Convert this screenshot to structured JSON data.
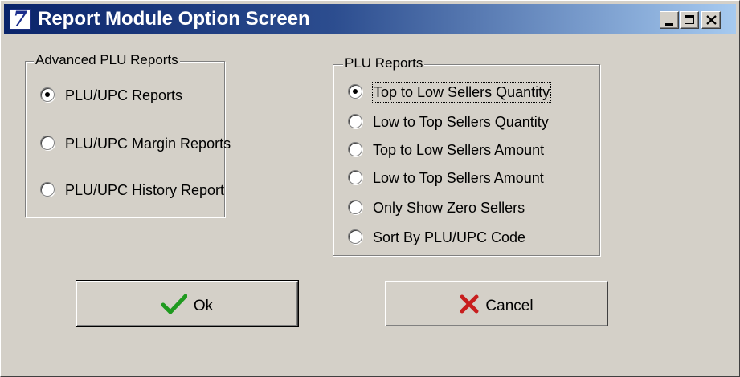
{
  "window": {
    "title": "Report Module Option Screen",
    "icon_glyph": "7",
    "controls": [
      "minimize-icon",
      "maximize-icon",
      "close-icon"
    ]
  },
  "advanced_group": {
    "legend": "Advanced PLU Reports",
    "options": [
      {
        "label": "PLU/UPC Reports",
        "checked": true
      },
      {
        "label": "PLU/UPC Margin Reports",
        "checked": false
      },
      {
        "label": "PLU/UPC History Report",
        "checked": false
      }
    ]
  },
  "plu_group": {
    "legend": "PLU Reports",
    "options": [
      {
        "label": "Top to Low Sellers Quantity",
        "checked": true
      },
      {
        "label": "Low to Top Sellers Quantity",
        "checked": false
      },
      {
        "label": "Top to Low Sellers Amount",
        "checked": false
      },
      {
        "label": "Low to Top Sellers Amount",
        "checked": false
      },
      {
        "label": "Only Show Zero Sellers",
        "checked": false
      },
      {
        "label": "Sort By PLU/UPC Code",
        "checked": false
      }
    ]
  },
  "buttons": {
    "ok_label": "Ok",
    "ok_icon": "check-icon",
    "cancel_label": "Cancel",
    "cancel_icon": "x-icon"
  },
  "colors": {
    "titlebar_start": "#0a246a",
    "titlebar_end": "#a6caf0",
    "face": "#d4d0c8",
    "check_green": "#1f9a1f",
    "cancel_red": "#c81e1e"
  }
}
